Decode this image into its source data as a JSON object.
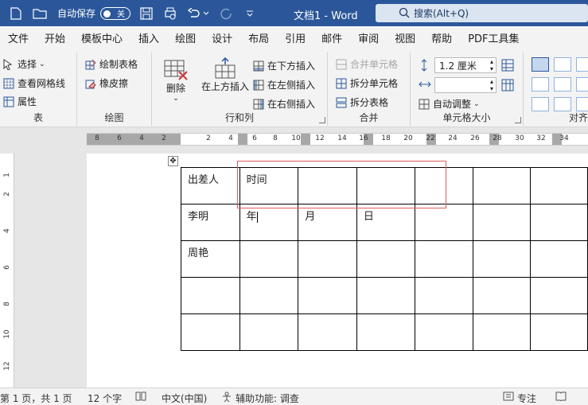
{
  "titlebar": {
    "autosave_label": "自动保存",
    "autosave_state": "关",
    "doc_title": "文档1 - Word",
    "search_label": "搜索(Alt+Q)",
    "bg_color": "#2b579a"
  },
  "menu": {
    "tabs": [
      "文件",
      "开始",
      "模板中心",
      "插入",
      "绘图",
      "设计",
      "布局",
      "引用",
      "邮件",
      "审阅",
      "视图",
      "帮助",
      "PDF工具集"
    ]
  },
  "ribbon": {
    "table_group": {
      "label": "表",
      "select": "选择",
      "gridlines": "查看网格线",
      "properties": "属性"
    },
    "draw_group": {
      "label": "绘图",
      "draw_table": "绘制表格",
      "eraser": "橡皮擦"
    },
    "rowcol_group": {
      "label": "行和列",
      "delete": "删除",
      "insert_above": "在上方插入",
      "insert_below": "在下方插入",
      "insert_left": "在左侧插入",
      "insert_right": "在右侧插入"
    },
    "merge_group": {
      "label": "合并",
      "merge_cells": "合并单元格",
      "split_cells": "拆分单元格",
      "split_table": "拆分表格"
    },
    "cellsize_group": {
      "label": "单元格大小",
      "height_value": "1.2 厘米",
      "width_value": "",
      "autofit": "自动调整"
    },
    "align_group": {
      "label": "对齐"
    }
  },
  "ruler": {
    "h_numbers": [
      "8",
      "6",
      "4",
      "2",
      "",
      "2",
      "4",
      "6",
      "8",
      "10",
      "12",
      "14",
      "16",
      "18",
      "20",
      "22",
      "24",
      "26",
      "28",
      "30",
      "32",
      "34"
    ],
    "v_numbers": [
      "1",
      "2",
      "1",
      "2",
      "4",
      "6",
      "8",
      "10",
      "12"
    ],
    "corner": "L"
  },
  "table": {
    "rows": [
      [
        "出差人",
        "时间",
        "",
        "",
        "",
        "",
        ""
      ],
      [
        "李明",
        "年",
        "月",
        "日",
        "",
        "",
        ""
      ],
      [
        "周艳",
        "",
        "",
        "",
        "",
        "",
        ""
      ],
      [
        "",
        "",
        "",
        "",
        "",
        "",
        ""
      ],
      [
        "",
        "",
        "",
        "",
        "",
        "",
        ""
      ]
    ]
  },
  "status": {
    "page": "第 1 页，共 1 页",
    "words": "12 个字",
    "language": "中文(中国)",
    "accessibility": "辅助功能: 调查",
    "focus": "专注"
  }
}
